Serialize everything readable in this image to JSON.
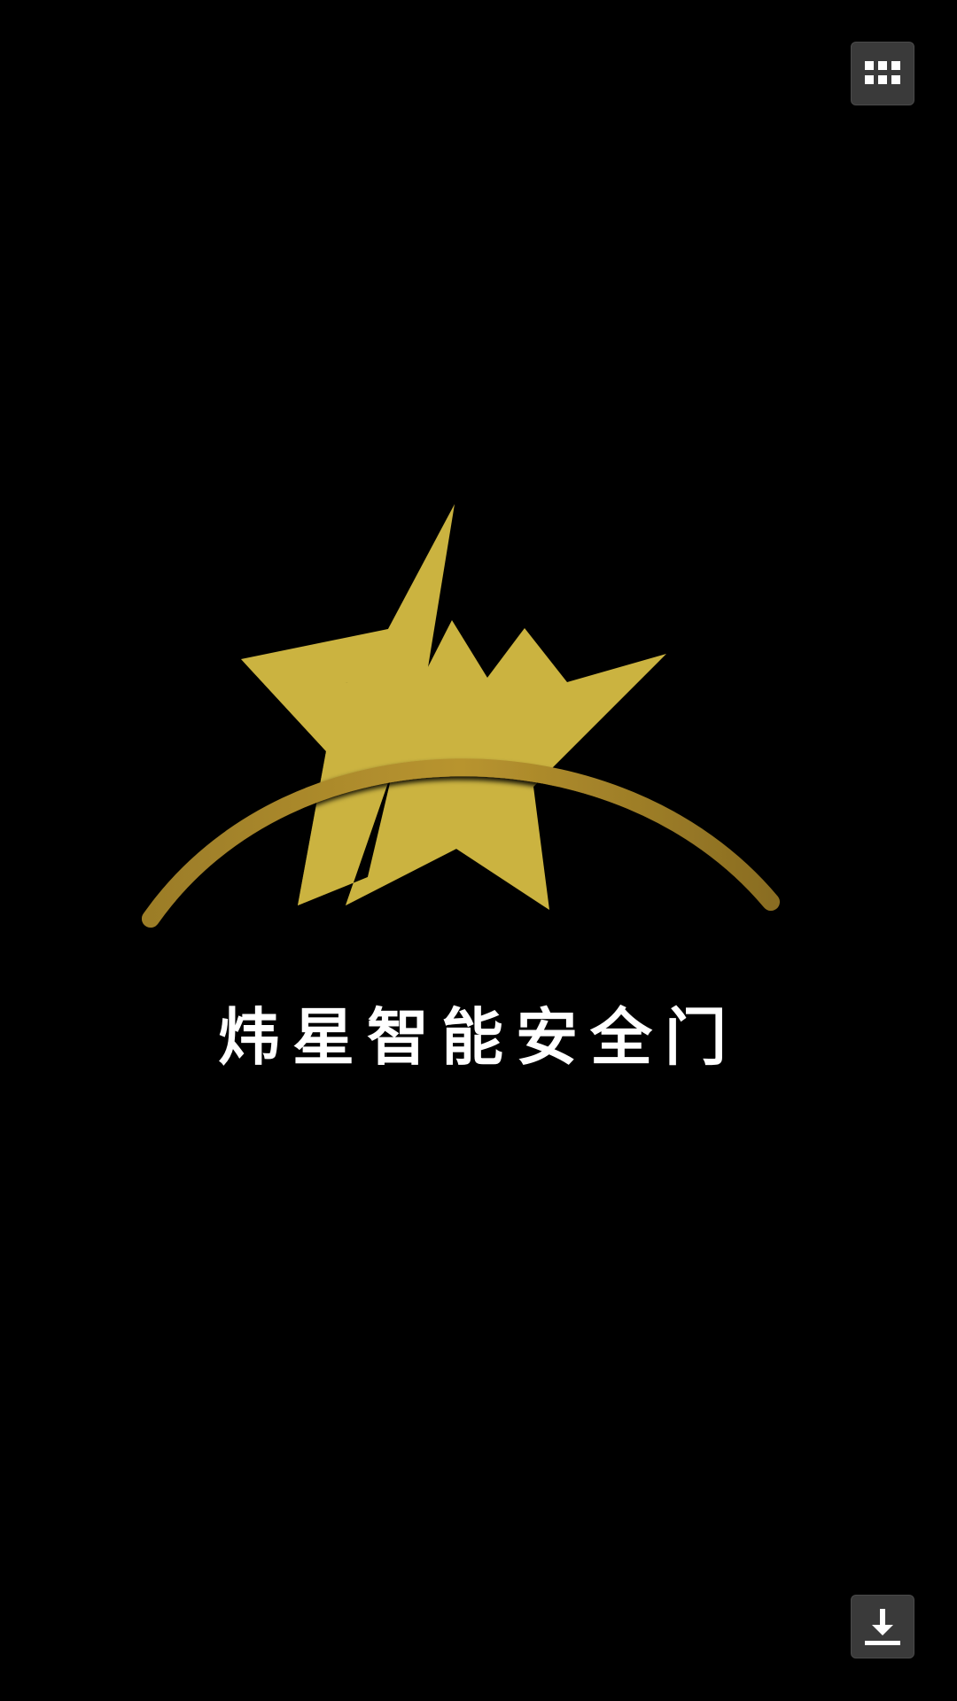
{
  "brand": {
    "name": "炜星智能安全门",
    "logo_colors": {
      "star": "#cbb33f",
      "arc": "#b48f30"
    }
  },
  "toolbar": {
    "menu_icon": "grid-menu-icon",
    "download_icon": "download-icon"
  },
  "colors": {
    "background": "#000000",
    "button_bg": "#3a3a3a",
    "icon": "#ffffff"
  }
}
